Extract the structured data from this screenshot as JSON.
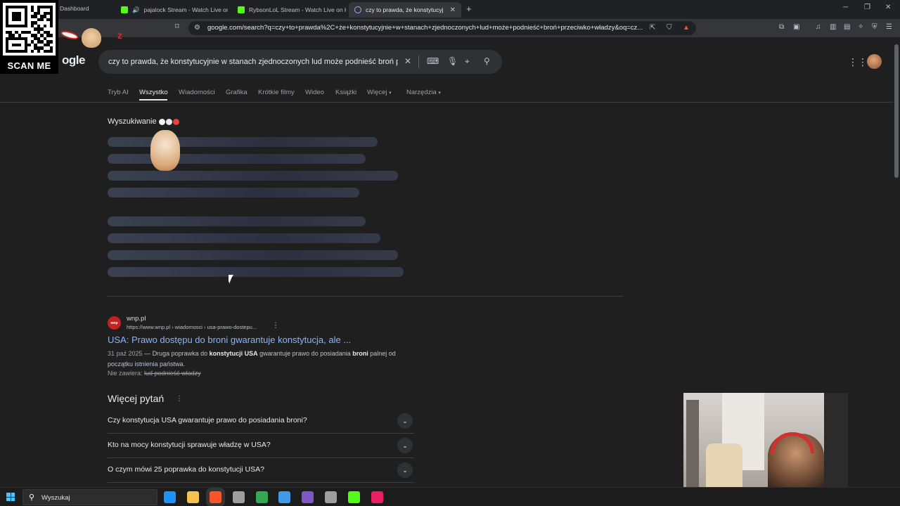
{
  "browser": {
    "tabs": [
      {
        "title": "pajalock Stream - Watch Live on"
      },
      {
        "title": "RybsonLoL Stream - Watch Live on K"
      },
      {
        "title": "czy to prawda, że konstytucyjnie"
      }
    ],
    "url": "google.com/search?q=czy+to+prawda%2C+że+konstytucyjnie+w+stanach+zjednoczonych+lud+może+podnieść+broń+przeciwko+władzy&oq=cz..."
  },
  "overlays": {
    "qr_label": "SCAN ME",
    "qr_partial_tab": "Dashboard"
  },
  "google": {
    "logo_fragment": "ogle",
    "query": "czy to prawda, że konstytucyjnie w stanach zjednoczonych lud może podnieść broń przeciwko władzy",
    "nav_tabs": [
      "Tryb AI",
      "Wszystko",
      "Wiadomości",
      "Grafika",
      "Krótkie filmy",
      "Wideo",
      "Książki",
      "Więcej",
      "Narzędzia"
    ],
    "active_nav_tab": "Wszystko",
    "ai_overview": {
      "title": "Wyszukiwanie",
      "dot_colors": [
        "#f1f3f4",
        "#e8eaed",
        "#ea4335"
      ]
    },
    "result": {
      "favicon_text": "wnp",
      "site_name": "wnp.pl",
      "cite": "https://www.wnp.pl › wiadomosci › usa-prawo-dostepu...",
      "title": "USA: Prawo dostępu do broni gwarantuje konstytucja, ale ...",
      "date": "31 paź 2025",
      "snippet_parts": [
        "Druga poprawka do ",
        "konstytucji USA",
        " gwarantuje prawo do posiadania ",
        "broni",
        " palnej od początku istnienia państwa."
      ],
      "missing_label": "Nie zawiera:",
      "missing_terms": "lud podnieść władzy"
    },
    "people_also_ask": {
      "title": "Więcej pytań",
      "questions": [
        "Czy konstytucja USA gwarantuje prawo do posiadania broni?",
        "Kto na mocy konstytucji sprawuje władzę w USA?",
        "O czym mówi 25 poprawka do konstytucji USA?"
      ]
    }
  },
  "taskbar": {
    "search_placeholder": "Wyszukaj",
    "app_colors": [
      "#1e90ff",
      "#f2c14e",
      "#fb542b",
      "#9e9e9e",
      "#34a853",
      "#3d9be9",
      "#7e57c2",
      "#9e9e9e",
      "#53fc18",
      "#e91e63"
    ]
  }
}
